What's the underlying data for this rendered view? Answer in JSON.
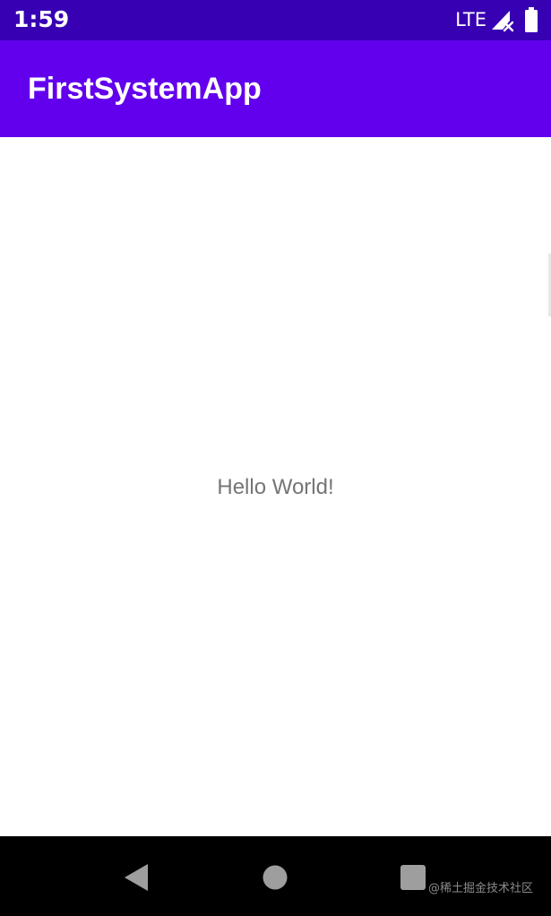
{
  "status_bar": {
    "time": "1:59",
    "network": "LTE",
    "signal_icon": "signal-no-data-icon",
    "battery_icon": "battery-full-icon",
    "background_color": "#3700b3"
  },
  "app_bar": {
    "title": "FirstSystemApp",
    "background_color": "#6200ee"
  },
  "content": {
    "message": "Hello World!"
  },
  "nav_bar": {
    "back_icon": "back-triangle-icon",
    "home_icon": "home-circle-icon",
    "recents_icon": "recents-square-icon"
  },
  "watermark": {
    "text": "@稀土掘金技术社区"
  }
}
